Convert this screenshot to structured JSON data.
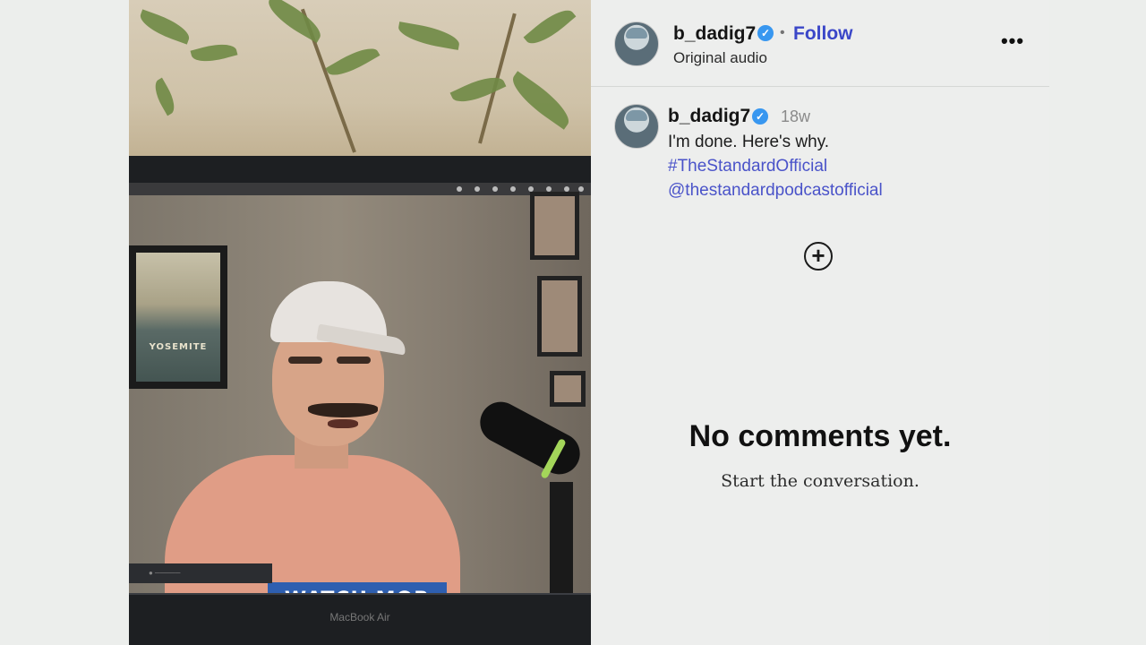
{
  "post": {
    "username": "b_dadig7",
    "separator": "•",
    "follow_label": "Follow",
    "audio_label": "Original audio",
    "more_icon": "more-options-icon",
    "verified_icon": "verified-badge-icon"
  },
  "caption": {
    "username": "b_dadig7",
    "time": "18w",
    "text": "I'm done. Here's why.",
    "hashtag": "#TheStandardOfficial",
    "mention": "@thestandardpodcastofficial"
  },
  "comments": {
    "add_icon": "plus-circle-icon",
    "empty_title": "No comments yet.",
    "empty_subtitle": "Start the conversation."
  },
  "video": {
    "poster_title": "YOSEMITE",
    "shirt_text": "WATCH MOR",
    "laptop_label": "MacBook Air"
  },
  "colors": {
    "follow": "#3a46c8",
    "link": "#4a53c9",
    "verified": "#3897f0"
  }
}
